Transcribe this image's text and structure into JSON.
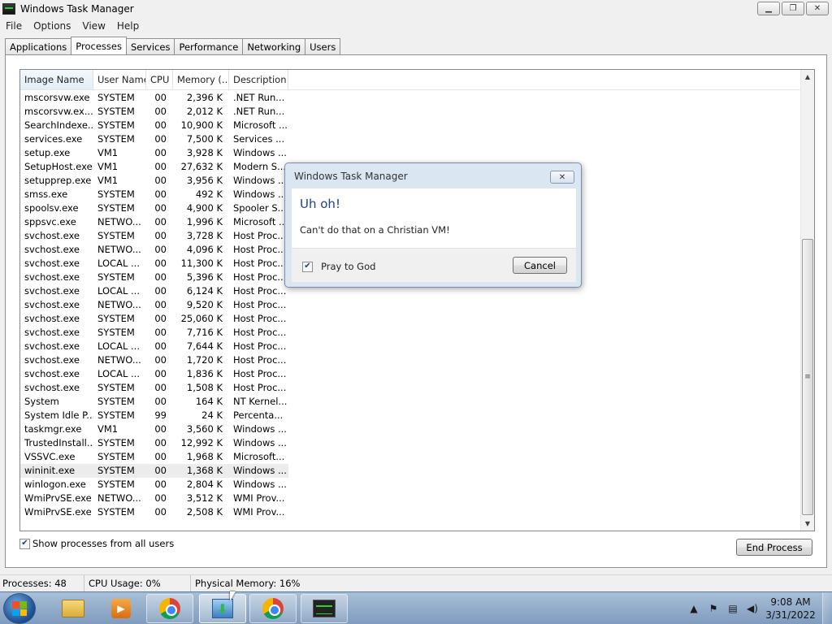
{
  "window": {
    "title": "Windows Task Manager",
    "minimize_icon": "minimize-icon",
    "restore_icon": "restore-icon",
    "close_icon": "close-icon"
  },
  "menu": [
    "File",
    "Options",
    "View",
    "Help"
  ],
  "tabs": [
    {
      "label": "Applications",
      "active": false
    },
    {
      "label": "Processes",
      "active": true
    },
    {
      "label": "Services",
      "active": false
    },
    {
      "label": "Performance",
      "active": false
    },
    {
      "label": "Networking",
      "active": false
    },
    {
      "label": "Users",
      "active": false
    }
  ],
  "columns": [
    "Image Name",
    "User Name",
    "CPU",
    "Memory (...",
    "Description"
  ],
  "processes": [
    [
      "mscorsvw.exe",
      "SYSTEM",
      "00",
      "2,396 K",
      ".NET Run..."
    ],
    [
      "mscorsvw.ex...",
      "SYSTEM",
      "00",
      "2,012 K",
      ".NET Run..."
    ],
    [
      "SearchIndexe...",
      "SYSTEM",
      "00",
      "10,900 K",
      "Microsoft ..."
    ],
    [
      "services.exe",
      "SYSTEM",
      "00",
      "7,500 K",
      "Services ..."
    ],
    [
      "setup.exe",
      "VM1",
      "00",
      "3,928 K",
      "Windows ..."
    ],
    [
      "SetupHost.exe",
      "VM1",
      "00",
      "27,632 K",
      "Modern S..."
    ],
    [
      "setupprep.exe",
      "VM1",
      "00",
      "3,956 K",
      "Windows ..."
    ],
    [
      "smss.exe",
      "SYSTEM",
      "00",
      "492 K",
      "Windows ..."
    ],
    [
      "spoolsv.exe",
      "SYSTEM",
      "00",
      "4,900 K",
      "Spooler S..."
    ],
    [
      "sppsvc.exe",
      "NETWO...",
      "00",
      "1,996 K",
      "Microsoft ..."
    ],
    [
      "svchost.exe",
      "SYSTEM",
      "00",
      "3,728 K",
      "Host Proc..."
    ],
    [
      "svchost.exe",
      "NETWO...",
      "00",
      "4,096 K",
      "Host Proc..."
    ],
    [
      "svchost.exe",
      "LOCAL ...",
      "00",
      "11,300 K",
      "Host Proc..."
    ],
    [
      "svchost.exe",
      "SYSTEM",
      "00",
      "5,396 K",
      "Host Proc..."
    ],
    [
      "svchost.exe",
      "LOCAL ...",
      "00",
      "6,124 K",
      "Host Proc..."
    ],
    [
      "svchost.exe",
      "NETWO...",
      "00",
      "9,520 K",
      "Host Proc..."
    ],
    [
      "svchost.exe",
      "SYSTEM",
      "00",
      "25,060 K",
      "Host Proc..."
    ],
    [
      "svchost.exe",
      "SYSTEM",
      "00",
      "7,716 K",
      "Host Proc..."
    ],
    [
      "svchost.exe",
      "LOCAL ...",
      "00",
      "7,644 K",
      "Host Proc..."
    ],
    [
      "svchost.exe",
      "NETWO...",
      "00",
      "1,720 K",
      "Host Proc..."
    ],
    [
      "svchost.exe",
      "LOCAL ...",
      "00",
      "1,836 K",
      "Host Proc..."
    ],
    [
      "svchost.exe",
      "SYSTEM",
      "00",
      "1,508 K",
      "Host Proc..."
    ],
    [
      "System",
      "SYSTEM",
      "00",
      "164 K",
      "NT Kernel..."
    ],
    [
      "System Idle P...",
      "SYSTEM",
      "99",
      "24 K",
      "Percenta..."
    ],
    [
      "taskmgr.exe",
      "VM1",
      "00",
      "3,560 K",
      "Windows ..."
    ],
    [
      "TrustedInstall...",
      "SYSTEM",
      "00",
      "12,992 K",
      "Windows ..."
    ],
    [
      "VSSVC.exe",
      "SYSTEM",
      "00",
      "1,968 K",
      "Microsoft..."
    ],
    [
      "wininit.exe",
      "SYSTEM",
      "00",
      "1,368 K",
      "Windows ..."
    ],
    [
      "winlogon.exe",
      "SYSTEM",
      "00",
      "2,804 K",
      "Windows ..."
    ],
    [
      "WmiPrvSE.exe",
      "NETWO...",
      "00",
      "3,512 K",
      "WMI Prov..."
    ],
    [
      "WmiPrvSE.exe",
      "SYSTEM",
      "00",
      "2,508 K",
      "WMI Prov..."
    ]
  ],
  "selected_process": "wininit.exe",
  "show_all_label": "Show processes from all users",
  "show_all_checked": true,
  "end_process_label": "End Process",
  "status": {
    "processes": "Processes: 48",
    "cpu": "CPU Usage: 0%",
    "memory": "Physical Memory: 16%"
  },
  "dialog": {
    "title": "Windows Task Manager",
    "heading": "Uh oh!",
    "message": "Can't do that on a Christian VM!",
    "checkbox_label": "Pray to God",
    "checkbox_checked": true,
    "cancel_label": "Cancel"
  },
  "taskbar": {
    "items": [
      {
        "name": "windows-explorer",
        "icon": "folder-icon",
        "state": "pinned"
      },
      {
        "name": "media-player",
        "icon": "media-player-icon",
        "state": "pinned"
      },
      {
        "name": "chrome",
        "icon": "chrome-icon",
        "state": "running"
      },
      {
        "name": "windows-setup",
        "icon": "setup-icon",
        "state": "running"
      },
      {
        "name": "chrome",
        "icon": "chrome-icon",
        "state": "running"
      },
      {
        "name": "task-manager",
        "icon": "task-manager-icon",
        "state": "running"
      }
    ],
    "tray_icons": [
      "tray-expand-icon",
      "action-center-icon",
      "network-icon",
      "volume-icon"
    ],
    "time": "9:08 AM",
    "date": "3/31/2022"
  },
  "colors": {
    "dialog_heading": "#1f3f8a",
    "window_background": "#f0f0f0",
    "taskbar": "#8fa9c8"
  }
}
